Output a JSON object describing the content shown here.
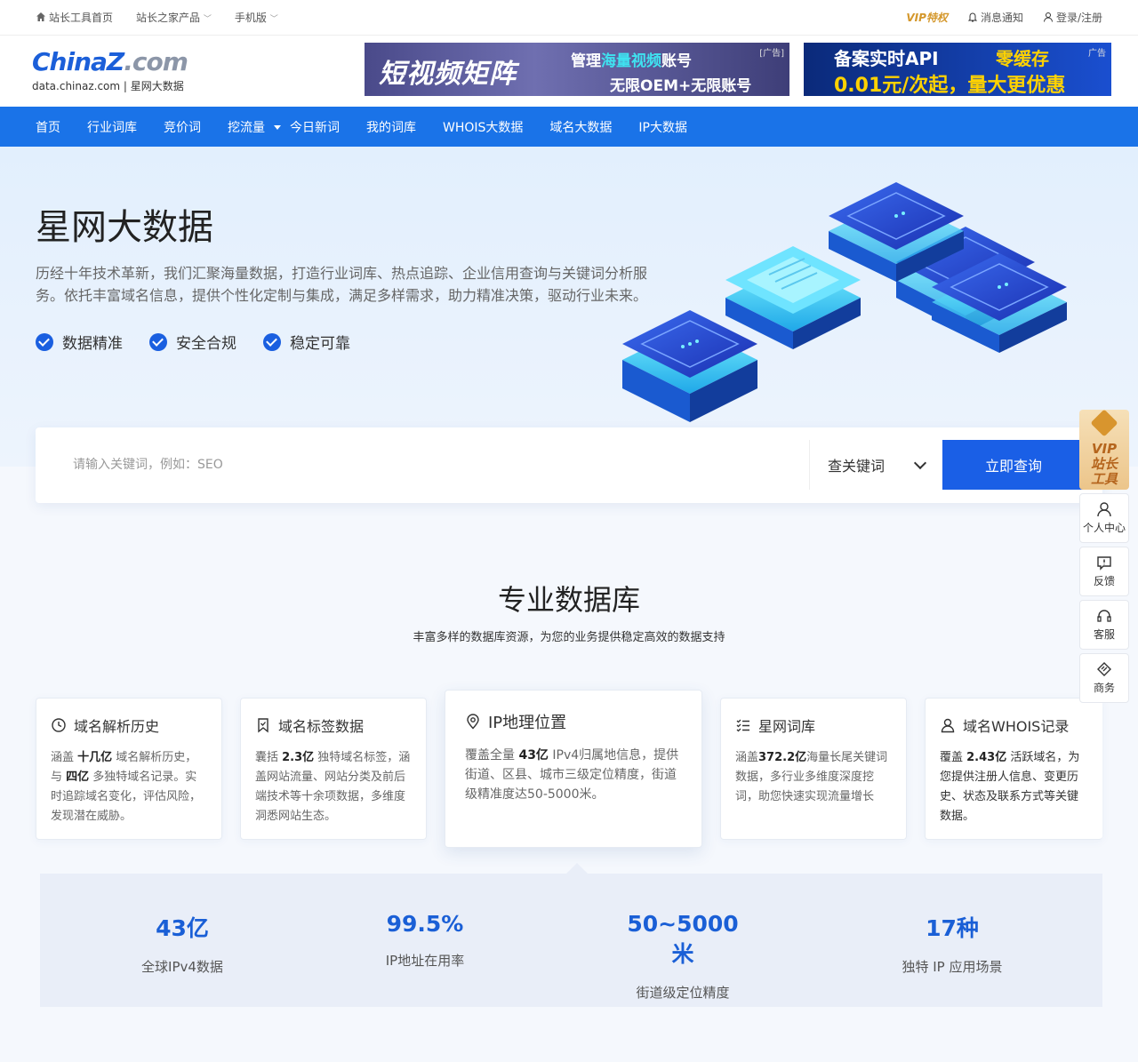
{
  "topbar": {
    "home": "站长工具首页",
    "products": "站长之家产品",
    "mobile": "手机版",
    "vip": "VIP特权",
    "notify": "消息通知",
    "login": "登录/注册"
  },
  "logo": {
    "brand_a": "China",
    "brand_z": "Z",
    "brand_b": ".com",
    "sub": "data.chinaz.com | 星网大数据"
  },
  "ads": {
    "ad1": {
      "big": "短视频矩阵",
      "line1a": "管理",
      "line1b": "海量视频",
      "line1c": "账号",
      "line2": "无限OEM+无限账号",
      "tag": "[广告]"
    },
    "ad2": {
      "t1": "备案实时API",
      "t1b": "零缓存",
      "t2": "0.01元/次起，量大更优惠",
      "tag": "广告"
    }
  },
  "nav": [
    "首页",
    "行业词库",
    "竞价词",
    "挖流量",
    "今日新词",
    "我的词库",
    "WHOIS大数据",
    "域名大数据",
    "IP大数据"
  ],
  "hero": {
    "title": "星网大数据",
    "desc": "历经十年技术革新，我们汇聚海量数据，打造行业词库、热点追踪、企业信用查询与关键词分析服务。依托丰富域名信息，提供个性化定制与集成，满足多样需求，助力精准决策，驱动行业未来。",
    "features": [
      "数据精准",
      "安全合规",
      "稳定可靠"
    ]
  },
  "search": {
    "placeholder": "请输入关键词，例如：SEO",
    "select": "查关键词",
    "button": "立即查询"
  },
  "section": {
    "title": "专业数据库",
    "subtitle": "丰富多样的数据库资源，为您的业务提供稳定高效的数据支持"
  },
  "cards": [
    {
      "icon": "history-icon",
      "title": "域名解析历史",
      "d": [
        "涵盖 ",
        "十几亿",
        " 域名解析历史，与 ",
        "四亿",
        " 多独特域名记录。实时追踪域名变化，评估风险，发现潜在威胁。"
      ]
    },
    {
      "icon": "bookmark-icon",
      "title": "域名标签数据",
      "d": [
        "囊括 ",
        "2.3亿",
        " 独特域名标签，涵盖网站流量、网站分类及前后端技术等十余项数据，多维度洞悉网站生态。",
        "",
        ""
      ]
    },
    {
      "icon": "location-pin-icon",
      "title": "IP地理位置",
      "d": [
        "覆盖全量 ",
        "43亿",
        " IPv4归属地信息，提供街道、区县、城市三级定位精度，街道级精准度达50-5000米。",
        "",
        ""
      ]
    },
    {
      "icon": "list-check-icon",
      "title": "星网词库",
      "d": [
        "涵盖",
        "372.2亿",
        "海量长尾关键词数据，多行业多维度深度挖词，助您快速实现流量增长",
        "",
        ""
      ]
    },
    {
      "icon": "user-icon",
      "title": "域名WHOIS记录",
      "d": [
        "覆盖 ",
        "2.43亿",
        " 活跃域名，为您提供注册人信息、变更历史、状态及联系方式等关键数据。",
        "",
        ""
      ]
    }
  ],
  "stats": [
    {
      "value": "43亿",
      "label": "全球IPv4数据"
    },
    {
      "value": "99.5%",
      "label": "IP地址在用率"
    },
    {
      "value": "50~5000米",
      "label": "街道级定位精度"
    },
    {
      "value": "17种",
      "label": "独特 IP 应用场景"
    }
  ],
  "float": {
    "vip_line1": "VIP",
    "vip_line2": "站长",
    "vip_line3": "工具",
    "items": [
      "个人中心",
      "反馈",
      "客服",
      "商务"
    ]
  },
  "colors": {
    "primary": "#1a73e8",
    "button": "#1a5fe6",
    "stat": "#1a5fd6",
    "vip": "#d4972b"
  }
}
